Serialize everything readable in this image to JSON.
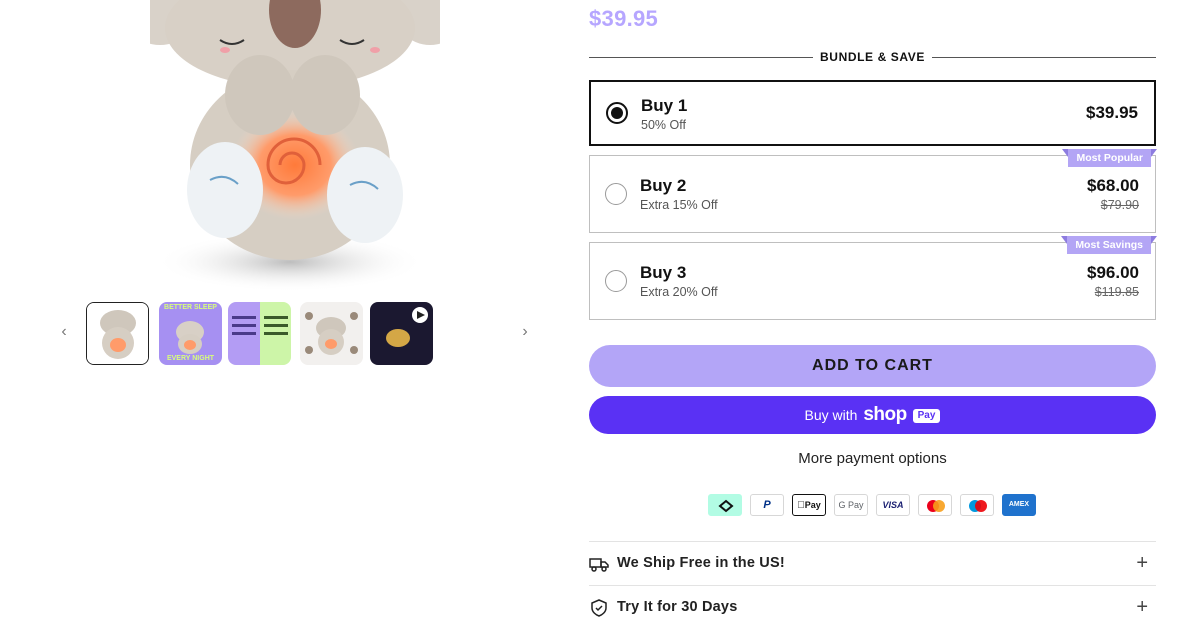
{
  "product": {
    "price": "$39.95"
  },
  "bundle": {
    "heading": "BUNDLE & SAVE",
    "options": [
      {
        "title": "Buy 1",
        "subtitle": "50% Off",
        "price": "$39.95",
        "old_price": "",
        "ribbon": "",
        "selected": true
      },
      {
        "title": "Buy 2",
        "subtitle": "Extra 15% Off",
        "price": "$68.00",
        "old_price": "$79.90",
        "ribbon": "Most Popular",
        "selected": false
      },
      {
        "title": "Buy 3",
        "subtitle": "Extra 20% Off",
        "price": "$96.00",
        "old_price": "$119.85",
        "ribbon": "Most Savings",
        "selected": false
      }
    ]
  },
  "gallery": {
    "prev_icon": "chevron-left-icon",
    "next_icon": "chevron-right-icon",
    "thumb_texts": [
      "BETTER SLEEP",
      "EVERY NIGHT"
    ]
  },
  "actions": {
    "add_to_cart": "ADD TO CART",
    "buy_with": "Buy with",
    "shop_word": "shop",
    "pay_badge": "Pay",
    "more_payment": "More payment options"
  },
  "payment_methods": [
    {
      "name": "Afterpay",
      "icon": "afterpay-icon",
      "label": "",
      "color": "#b2fce4"
    },
    {
      "name": "PayPal",
      "icon": "paypal-icon",
      "label": "P",
      "color": "#003087"
    },
    {
      "name": "Apple Pay",
      "icon": "apple-pay-icon",
      "label": "Pay",
      "color": "#000000"
    },
    {
      "name": "Google Pay",
      "icon": "google-pay-icon",
      "label": "G Pay",
      "color": "#5f6368"
    },
    {
      "name": "Visa",
      "icon": "visa-icon",
      "label": "VISA",
      "color": "#1a1f71"
    },
    {
      "name": "Mastercard",
      "icon": "mastercard-icon",
      "label": "",
      "color": "#eb001b"
    },
    {
      "name": "Maestro",
      "icon": "maestro-icon",
      "label": "",
      "color": "#0099df"
    },
    {
      "name": "American Express",
      "icon": "amex-icon",
      "label": "AMEX",
      "color": "#1f72cd"
    }
  ],
  "accordions": [
    {
      "label": "We Ship Free in the US!",
      "icon": "truck-icon"
    },
    {
      "label": "Try It for 30 Days",
      "icon": "shield-check-icon"
    }
  ],
  "colors": {
    "accent": "#b3a5f7",
    "shop_pay": "#5a31f4",
    "price": "#b6a6ff"
  }
}
